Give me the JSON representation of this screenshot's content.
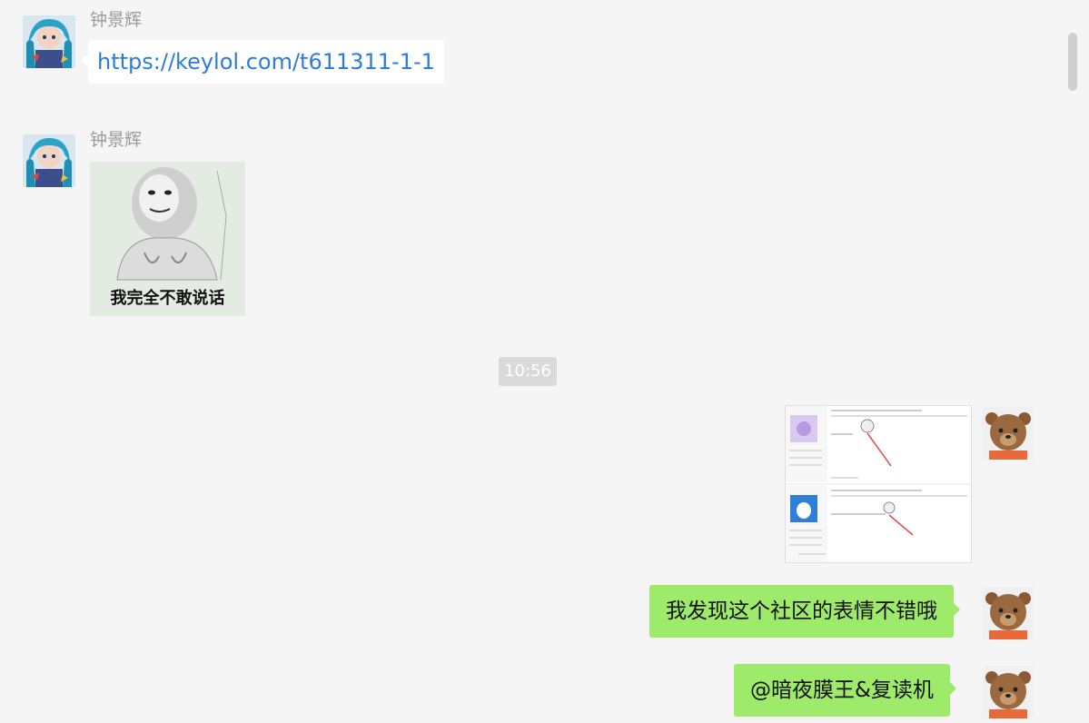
{
  "messages": {
    "m1": {
      "sender": "钟景辉",
      "text": "https://keylol.com/t611311-1-1"
    },
    "m2": {
      "sender": "钟景辉",
      "sticker_caption": "我完全不敢说话"
    },
    "timestamp": "10:56",
    "m4": {
      "text": "我发现这个社区的表情不错哦"
    },
    "m5": {
      "text": "@暗夜膜王&复读机"
    }
  },
  "icons": {
    "contact_avatar": "anime-avatar-icon",
    "self_avatar": "bear-avatar-icon"
  },
  "colors": {
    "background": "#f5f5f5",
    "incoming_bubble": "#ffffff",
    "outgoing_bubble": "#9eea6a",
    "link": "#2e7cd9",
    "timestamp_bg": "#dadada"
  }
}
